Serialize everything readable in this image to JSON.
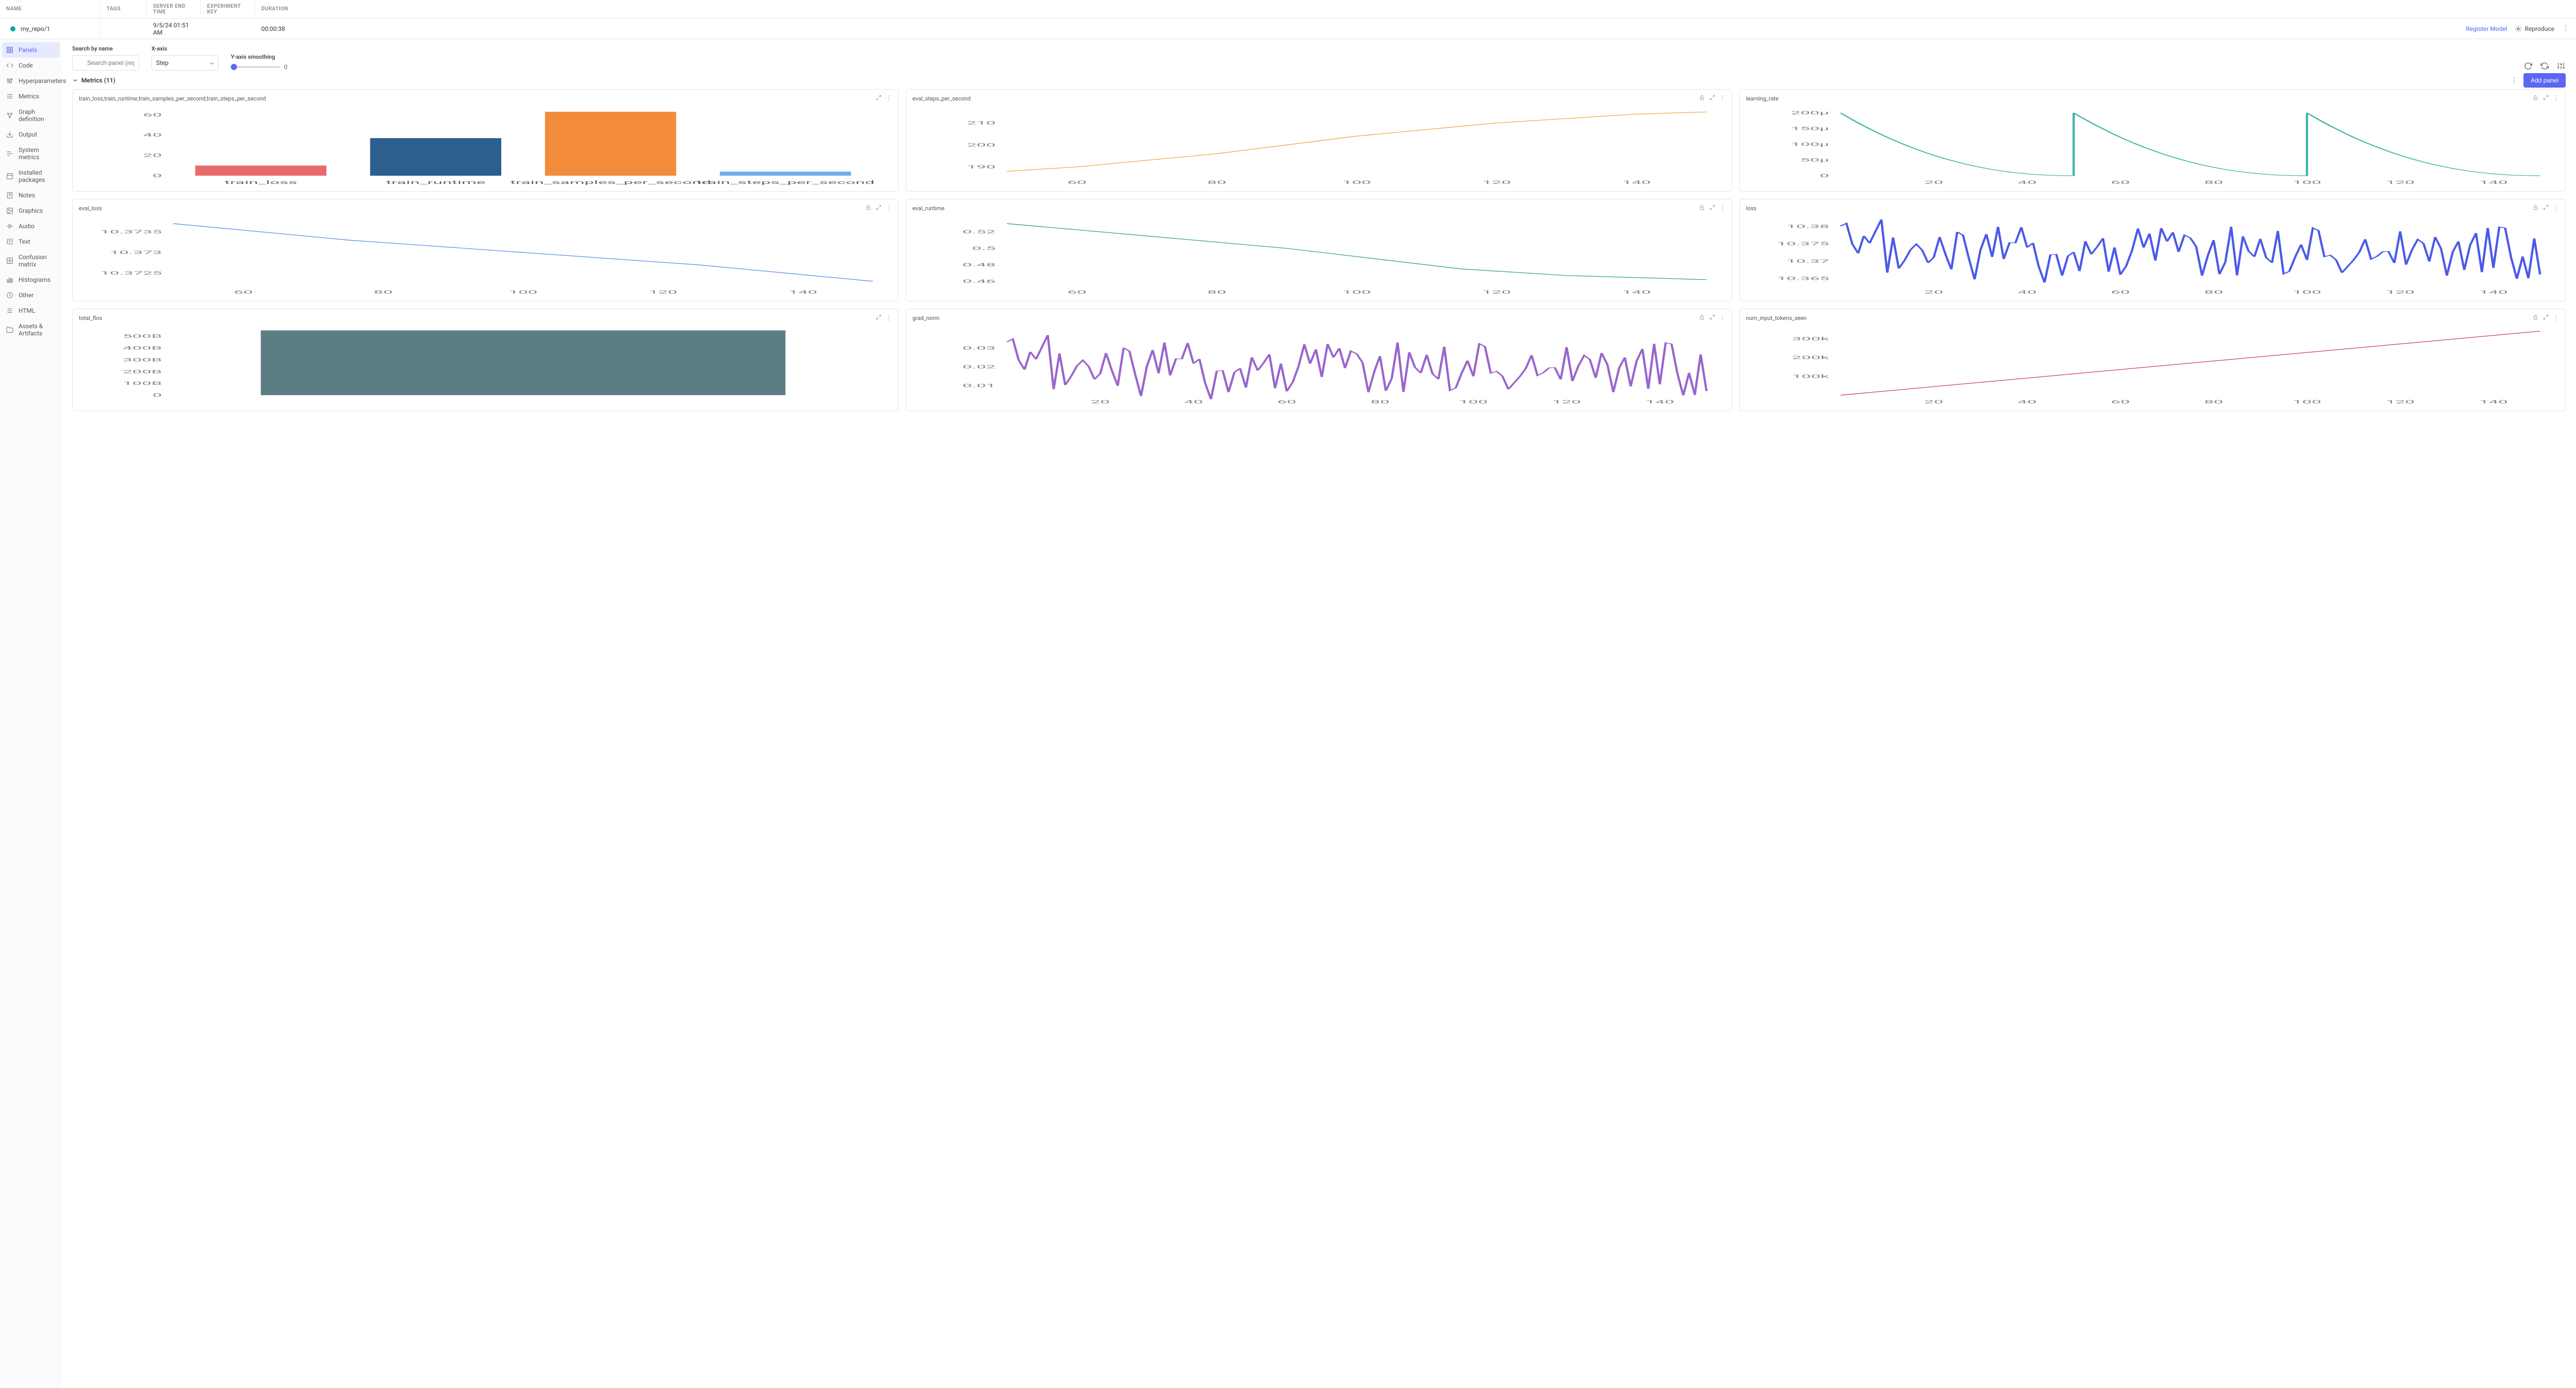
{
  "header": {
    "cols": {
      "name": "NAME",
      "tags": "TAGS",
      "endtime": "SERVER END TIME",
      "expkey": "EXPERIMENT KEY",
      "duration": "DURATION"
    },
    "values": {
      "name": "my_repo/1",
      "tags": "",
      "endtime": "9/5/24 01:51 AM",
      "expkey": "",
      "duration": "00:00:38"
    },
    "register": "Register Model",
    "reproduce": "Reproduce"
  },
  "sidebar": {
    "items": [
      {
        "label": "Panels",
        "icon": "grid"
      },
      {
        "label": "Code",
        "icon": "code"
      },
      {
        "label": "Hyperparameters",
        "icon": "sliders-v"
      },
      {
        "label": "Metrics",
        "icon": "lines"
      },
      {
        "label": "Graph definition",
        "icon": "network"
      },
      {
        "label": "Output",
        "icon": "download"
      },
      {
        "label": "System metrics",
        "icon": "bars"
      },
      {
        "label": "Installed packages",
        "icon": "package"
      },
      {
        "label": "Notes",
        "icon": "note"
      },
      {
        "label": "Graphics",
        "icon": "image"
      },
      {
        "label": "Audio",
        "icon": "audio"
      },
      {
        "label": "Text",
        "icon": "text"
      },
      {
        "label": "Confusion matrix",
        "icon": "matrix"
      },
      {
        "label": "Histograms",
        "icon": "histogram"
      },
      {
        "label": "Other",
        "icon": "circle"
      },
      {
        "label": "HTML",
        "icon": "html"
      },
      {
        "label": "Assets & Artifacts",
        "icon": "folder"
      }
    ]
  },
  "controls": {
    "search_label": "Search by name",
    "search_placeholder": "Search panel (regex)",
    "xaxis_label": "X-axis",
    "xaxis_value": "Step",
    "smooth_label": "Y-axis smoothing",
    "smooth_value": "0"
  },
  "section": {
    "title": "Metrics (11)",
    "add_panel": "Add panel"
  },
  "panels": [
    {
      "title": "train_loss,train_runtime,train_samples_per_second,train_steps_per_second",
      "icons": [
        "expand",
        "dots"
      ]
    },
    {
      "title": "eval_steps_per_second",
      "icons": [
        "lock",
        "expand",
        "dots"
      ]
    },
    {
      "title": "learning_rate",
      "icons": [
        "lock",
        "expand",
        "dots"
      ]
    },
    {
      "title": "eval_loss",
      "icons": [
        "lock",
        "expand",
        "dots"
      ]
    },
    {
      "title": "eval_runtime",
      "icons": [
        "lock",
        "expand",
        "dots"
      ]
    },
    {
      "title": "loss",
      "icons": [
        "lock",
        "expand",
        "dots"
      ]
    },
    {
      "title": "total_flos",
      "icons": [
        "expand",
        "dots"
      ]
    },
    {
      "title": "grad_norm",
      "icons": [
        "lock",
        "expand",
        "dots"
      ]
    },
    {
      "title": "num_input_tokens_seen",
      "icons": [
        "lock",
        "expand",
        "dots"
      ]
    }
  ],
  "chart_data": [
    {
      "type": "bar",
      "title": "train_loss,train_runtime,train_samples_per_second,train_steps_per_second",
      "categories": [
        "train_loss",
        "train_runtime",
        "train_samples_per_second",
        "train_steps_per_second"
      ],
      "values": [
        10,
        37,
        63,
        4
      ],
      "colors": [
        "#e86b6b",
        "#2d5f8e",
        "#f28c3a",
        "#6bb0e8"
      ],
      "yticks": [
        0,
        20,
        40,
        60
      ],
      "ylim": [
        0,
        65
      ]
    },
    {
      "type": "line",
      "title": "eval_steps_per_second",
      "x": [
        50,
        60,
        70,
        80,
        90,
        100,
        110,
        120,
        130,
        140,
        150
      ],
      "values": [
        188,
        190,
        193,
        196,
        200,
        204,
        207,
        210,
        212,
        214,
        215
      ],
      "color": "#f2a640",
      "xticks": [
        60,
        80,
        100,
        120,
        140
      ],
      "yticks": [
        190,
        200,
        210
      ],
      "ylim": [
        186,
        216
      ]
    },
    {
      "type": "line",
      "title": "learning_rate",
      "x_range": [
        0,
        150
      ],
      "pattern": "sawtooth_decay",
      "periods": 3,
      "peak": 200,
      "unit": "μ",
      "color": "#3fb5a8",
      "xticks": [
        20,
        40,
        60,
        80,
        100,
        120,
        140
      ],
      "yticks": [
        "0",
        "50μ",
        "100μ",
        "150μ",
        "200μ"
      ],
      "ylim": [
        0,
        210
      ]
    },
    {
      "type": "line",
      "title": "eval_loss",
      "x": [
        50,
        75,
        100,
        125,
        150
      ],
      "values": [
        10.3737,
        10.3733,
        10.373,
        10.3727,
        10.3723
      ],
      "color": "#5b8de8",
      "xticks": [
        60,
        80,
        100,
        120,
        140
      ],
      "yticks": [
        10.3725,
        10.373,
        10.3735
      ],
      "ylim": [
        10.3722,
        10.3738
      ]
    },
    {
      "type": "line",
      "title": "eval_runtime",
      "x": [
        50,
        70,
        90,
        100,
        115,
        130,
        150
      ],
      "values": [
        0.53,
        0.515,
        0.5,
        0.49,
        0.475,
        0.467,
        0.462
      ],
      "color": "#2ea380",
      "xticks": [
        60,
        80,
        100,
        120,
        140
      ],
      "yticks": [
        0.46,
        0.48,
        0.5,
        0.52
      ],
      "ylim": [
        0.455,
        0.535
      ]
    },
    {
      "type": "line",
      "title": "loss",
      "pattern": "noisy",
      "mean": 10.373,
      "range": [
        10.365,
        10.381
      ],
      "x_range": [
        0,
        150
      ],
      "color": "#4a5be8",
      "xticks": [
        20,
        40,
        60,
        80,
        100,
        120,
        140
      ],
      "yticks": [
        10.365,
        10.37,
        10.375,
        10.38
      ],
      "ylim": [
        10.363,
        10.382
      ]
    },
    {
      "type": "bar",
      "title": "total_flos",
      "categories": [
        "total_flos"
      ],
      "values": [
        550
      ],
      "unit": "B",
      "colors": [
        "#5d7d85"
      ],
      "yticks": [
        "0",
        "100B",
        "200B",
        "300B",
        "400B",
        "500B"
      ],
      "ylim": [
        0,
        560
      ]
    },
    {
      "type": "line",
      "title": "grad_norm",
      "pattern": "noisy",
      "mean": 0.02,
      "range": [
        0.008,
        0.038
      ],
      "x_range": [
        0,
        150
      ],
      "color": "#9966cc",
      "xticks": [
        20,
        40,
        60,
        80,
        100,
        120,
        140
      ],
      "yticks": [
        0.01,
        0.02,
        0.03
      ],
      "ylim": [
        0.005,
        0.04
      ]
    },
    {
      "type": "line",
      "title": "num_input_tokens_seen",
      "x": [
        0,
        150
      ],
      "values": [
        0,
        340000
      ],
      "unit": "k",
      "color": "#c83878",
      "xticks": [
        20,
        40,
        60,
        80,
        100,
        120,
        140
      ],
      "yticks": [
        "100k",
        "200k",
        "300k"
      ],
      "ylim": [
        0,
        350000
      ]
    }
  ]
}
